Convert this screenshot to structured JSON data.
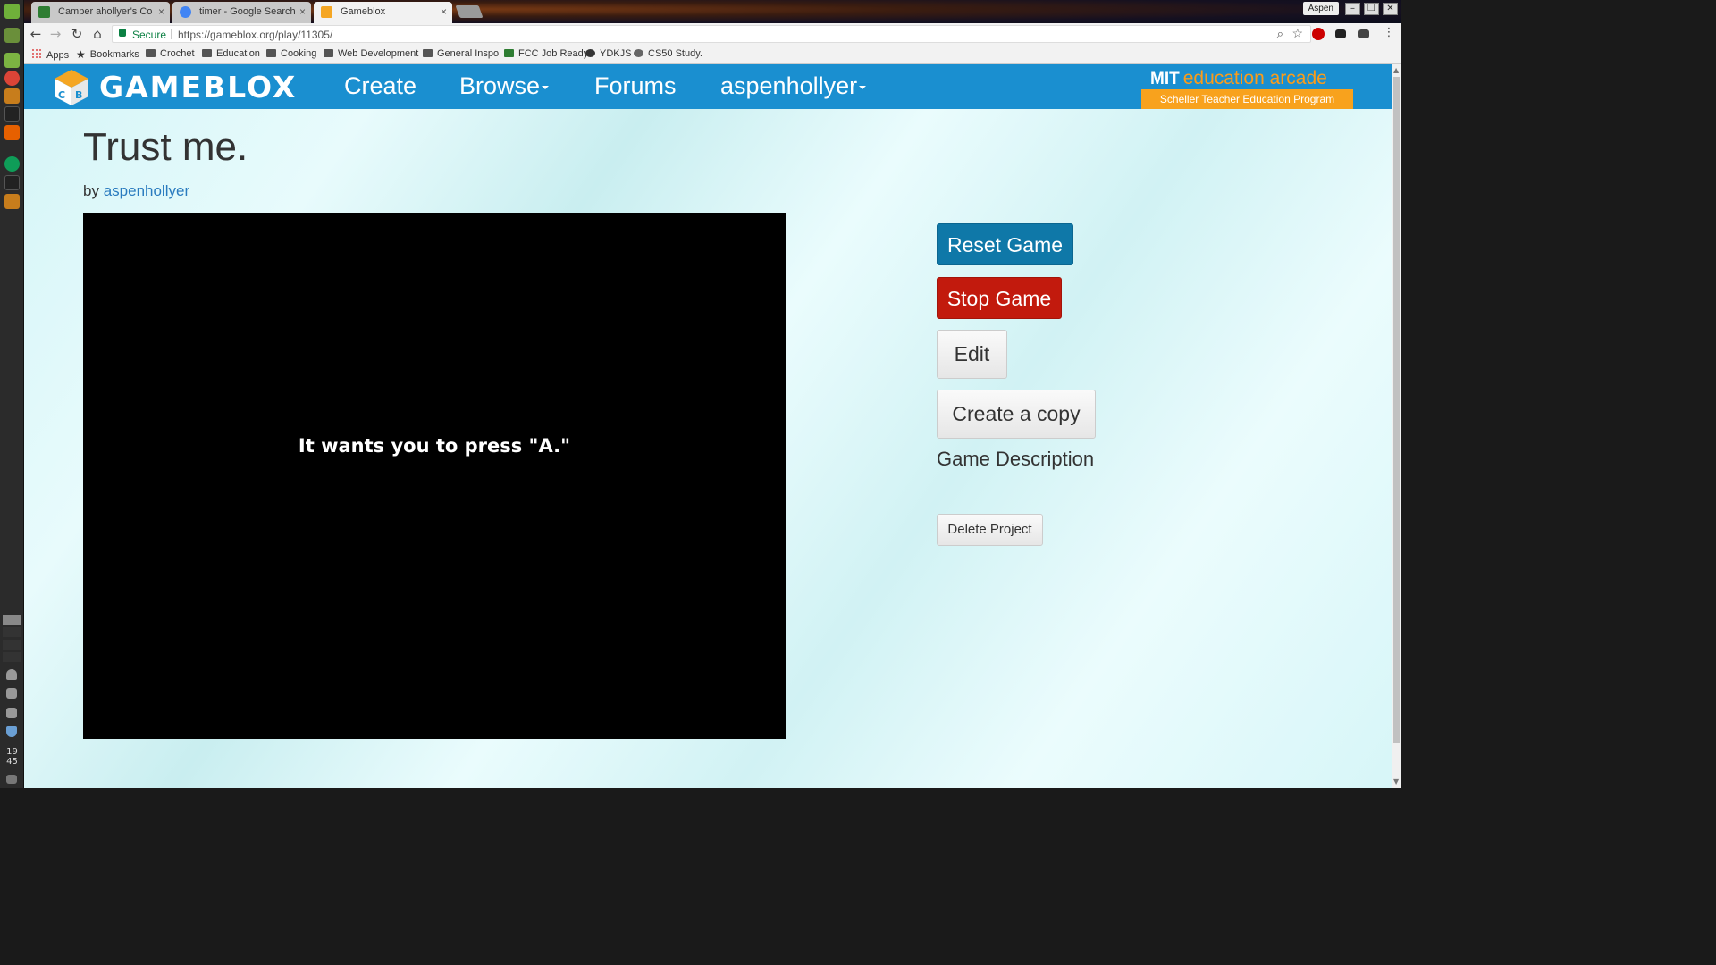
{
  "browser": {
    "tabs": [
      {
        "title": "Camper ahollyer's Co",
        "favicon_color": "#2e7d32",
        "active": false
      },
      {
        "title": "timer - Google Search",
        "favicon_color": "#4285f4",
        "active": false
      },
      {
        "title": "Gameblox",
        "favicon_color": "#f5a623",
        "active": true
      }
    ],
    "profile_name": "Aspen",
    "secure_label": "Secure",
    "url": "https://gameblox.org/play/11305/",
    "bookmarks": [
      "Apps",
      "Bookmarks",
      "Crochet",
      "Education",
      "Cooking",
      "Web Development",
      "General Inspo",
      "FCC Job Ready",
      "YDKJS",
      "CS50 Study."
    ]
  },
  "os": {
    "clock_hour": "19",
    "clock_minute": "45"
  },
  "site": {
    "brand": "GAMEBLOX",
    "nav": {
      "create": "Create",
      "browse": "Browse",
      "forums": "Forums",
      "user": "aspenhollyer"
    },
    "partner_mit": "MIT",
    "partner": "education arcade",
    "partner_sub": "Scheller Teacher Education Program"
  },
  "project": {
    "title": "Trust me.",
    "by_prefix": "by",
    "author": "aspenhollyer",
    "game_message": "It wants you to press \"A.\"",
    "buttons": {
      "reset": "Reset Game",
      "stop": "Stop Game",
      "edit": "Edit",
      "copy": "Create a copy",
      "delete": "Delete Project"
    },
    "description_heading": "Game Description"
  },
  "colors": {
    "navbar": "#1a8fd0",
    "reset_button": "#0f78a8",
    "stop_button": "#c21a0d",
    "accent_orange": "#f8a21d"
  }
}
